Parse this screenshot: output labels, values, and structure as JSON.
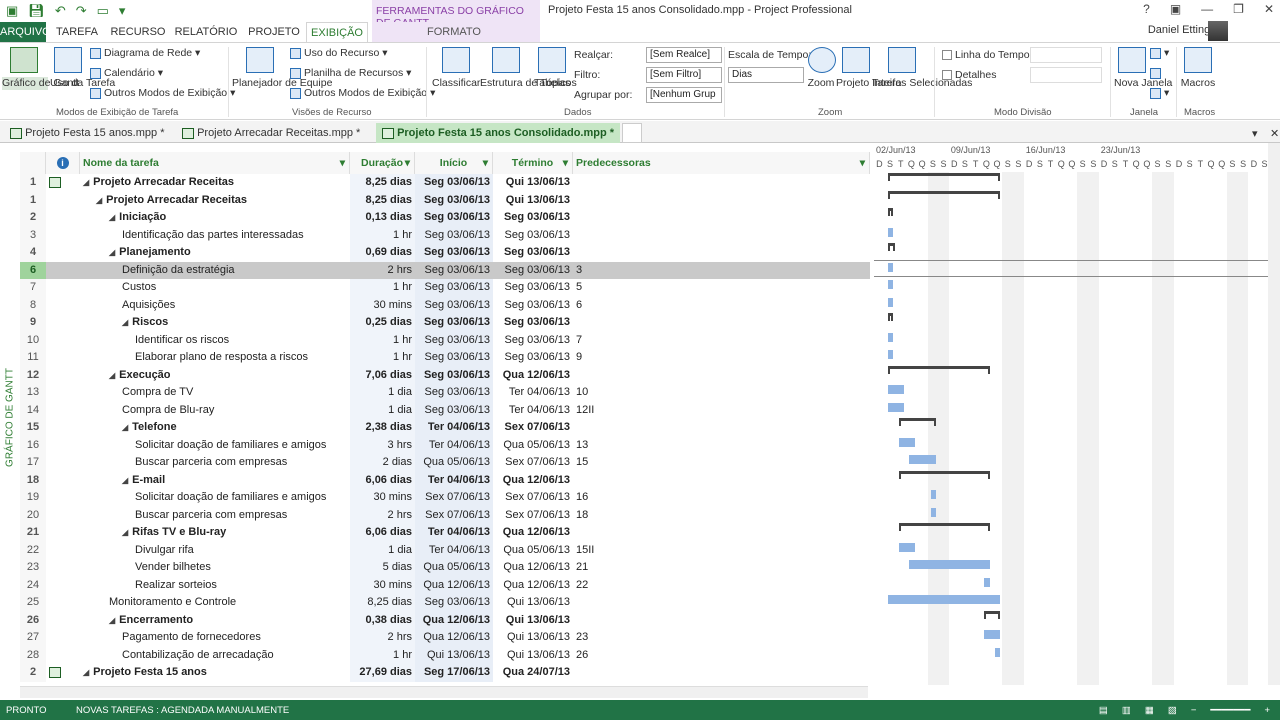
{
  "window": {
    "context_tab_group": "FERRAMENTAS DO GRÁFICO DE GANTT",
    "title": "Projeto Festa 15 anos Consolidado.mpp - Project Professional",
    "user_name": "Daniel Ettinger"
  },
  "ribbon_tabs": [
    "ARQUIVO",
    "TAREFA",
    "RECURSO",
    "RELATÓRIO",
    "PROJETO",
    "EXIBIÇÃO",
    "FORMATO"
  ],
  "ribbon": {
    "task_views": {
      "gantt": "Gráfico de Gantt",
      "task_usage": "Uso da Tarefa",
      "network": "Diagrama de Rede",
      "calendar": "Calendário",
      "other": "Outros Modos de Exibição",
      "label": "Modos de Exibição de Tarefa"
    },
    "resource_views": {
      "planner": "Planejador de Equipe",
      "resource_usage": "Uso do Recurso",
      "resource_sheet": "Planilha de Recursos",
      "other": "Outros Modos de Exibição",
      "label": "Visões de Recurso"
    },
    "data": {
      "sort": "Classificar",
      "outline": "Estrutura de Tópicos",
      "tables": "Tabelas",
      "highlight_label": "Realçar:",
      "highlight_value": "[Sem Realce]",
      "filter_label": "Filtro:",
      "filter_value": "[Sem Filtro]",
      "group_label": "Agrupar por:",
      "group_value": "[Nenhum Grup",
      "label": "Dados"
    },
    "zoom": {
      "timescale_label": "Escala de Tempo:",
      "timescale_value": "Dias",
      "zoom": "Zoom",
      "entire_project": "Projeto Inteiro",
      "selected_tasks": "Tarefas Selecionadas",
      "label": "Zoom"
    },
    "split": {
      "timeline": "Linha do Tempo",
      "details": "Detalhes",
      "label": "Modo Divisão"
    },
    "window": {
      "new_window": "Nova Janela",
      "label": "Janela"
    },
    "macros": {
      "macros": "Macros",
      "label": "Macros"
    }
  },
  "doc_tabs": [
    "Projeto Festa 15 anos.mpp *",
    "Projeto Arrecadar Receitas.mpp *",
    "Projeto Festa 15 anos Consolidado.mpp *"
  ],
  "side_label": "GRÁFICO DE GANTT",
  "columns": {
    "name": "Nome da tarefa",
    "duration": "Duração",
    "start": "Início",
    "finish": "Término",
    "predecessors": "Predecessoras"
  },
  "rows": [
    {
      "id": "1",
      "name": "Projeto Arrecadar Receitas",
      "dur": "8,25 dias",
      "start": "Seg 03/06/13",
      "end": "Qui 13/06/13",
      "pred": "",
      "level": 0,
      "summary": true,
      "icon": "subproject-icon"
    },
    {
      "id": "1",
      "name": "Projeto Arrecadar Receitas",
      "dur": "8,25 dias",
      "start": "Seg 03/06/13",
      "end": "Qui 13/06/13",
      "pred": "",
      "level": 1,
      "summary": true
    },
    {
      "id": "2",
      "name": "Iniciação",
      "dur": "0,13 dias",
      "start": "Seg 03/06/13",
      "end": "Seg 03/06/13",
      "pred": "",
      "level": 2,
      "summary": true
    },
    {
      "id": "3",
      "name": "Identificação das partes interessadas",
      "dur": "1 hr",
      "start": "Seg 03/06/13",
      "end": "Seg 03/06/13",
      "pred": "",
      "level": 3
    },
    {
      "id": "4",
      "name": "Planejamento",
      "dur": "0,69 dias",
      "start": "Seg 03/06/13",
      "end": "Seg 03/06/13",
      "pred": "",
      "level": 2,
      "summary": true
    },
    {
      "id": "6",
      "name": "Definição da estratégia",
      "dur": "2 hrs",
      "start": "Seg 03/06/13",
      "end": "Seg 03/06/13",
      "pred": "3",
      "level": 3,
      "selected": true
    },
    {
      "id": "7",
      "name": "Custos",
      "dur": "1 hr",
      "start": "Seg 03/06/13",
      "end": "Seg 03/06/13",
      "pred": "5",
      "level": 3
    },
    {
      "id": "8",
      "name": "Aquisições",
      "dur": "30 mins",
      "start": "Seg 03/06/13",
      "end": "Seg 03/06/13",
      "pred": "6",
      "level": 3
    },
    {
      "id": "9",
      "name": "Riscos",
      "dur": "0,25 dias",
      "start": "Seg 03/06/13",
      "end": "Seg 03/06/13",
      "pred": "",
      "level": 3,
      "summary": true
    },
    {
      "id": "10",
      "name": "Identificar os riscos",
      "dur": "1 hr",
      "start": "Seg 03/06/13",
      "end": "Seg 03/06/13",
      "pred": "7",
      "level": 4
    },
    {
      "id": "11",
      "name": "Elaborar plano de resposta a riscos",
      "dur": "1 hr",
      "start": "Seg 03/06/13",
      "end": "Seg 03/06/13",
      "pred": "9",
      "level": 4
    },
    {
      "id": "12",
      "name": "Execução",
      "dur": "7,06 dias",
      "start": "Seg 03/06/13",
      "end": "Qua 12/06/13",
      "pred": "",
      "level": 2,
      "summary": true
    },
    {
      "id": "13",
      "name": "Compra de TV",
      "dur": "1 dia",
      "start": "Seg 03/06/13",
      "end": "Ter 04/06/13",
      "pred": "10",
      "level": 3
    },
    {
      "id": "14",
      "name": "Compra de Blu-ray",
      "dur": "1 dia",
      "start": "Seg 03/06/13",
      "end": "Ter 04/06/13",
      "pred": "12II",
      "level": 3
    },
    {
      "id": "15",
      "name": "Telefone",
      "dur": "2,38 dias",
      "start": "Ter 04/06/13",
      "end": "Sex 07/06/13",
      "pred": "",
      "level": 3,
      "summary": true
    },
    {
      "id": "16",
      "name": "Solicitar doação de familiares e amigos",
      "dur": "3 hrs",
      "start": "Ter 04/06/13",
      "end": "Qua 05/06/13",
      "pred": "13",
      "level": 4
    },
    {
      "id": "17",
      "name": "Buscar parceria com empresas",
      "dur": "2 dias",
      "start": "Qua 05/06/13",
      "end": "Sex 07/06/13",
      "pred": "15",
      "level": 4
    },
    {
      "id": "18",
      "name": "E-mail",
      "dur": "6,06 dias",
      "start": "Ter 04/06/13",
      "end": "Qua 12/06/13",
      "pred": "",
      "level": 3,
      "summary": true
    },
    {
      "id": "19",
      "name": "Solicitar doação de familiares e amigos",
      "dur": "30 mins",
      "start": "Sex 07/06/13",
      "end": "Sex 07/06/13",
      "pred": "16",
      "level": 4
    },
    {
      "id": "20",
      "name": "Buscar parceria com empresas",
      "dur": "2 hrs",
      "start": "Sex 07/06/13",
      "end": "Sex 07/06/13",
      "pred": "18",
      "level": 4
    },
    {
      "id": "21",
      "name": "Rifas TV e Blu-ray",
      "dur": "6,06 dias",
      "start": "Ter 04/06/13",
      "end": "Qua 12/06/13",
      "pred": "",
      "level": 3,
      "summary": true
    },
    {
      "id": "22",
      "name": "Divulgar rifa",
      "dur": "1 dia",
      "start": "Ter 04/06/13",
      "end": "Qua 05/06/13",
      "pred": "15II",
      "level": 4
    },
    {
      "id": "23",
      "name": "Vender bilhetes",
      "dur": "5 dias",
      "start": "Qua 05/06/13",
      "end": "Qua 12/06/13",
      "pred": "21",
      "level": 4
    },
    {
      "id": "24",
      "name": "Realizar sorteios",
      "dur": "30 mins",
      "start": "Qua 12/06/13",
      "end": "Qua 12/06/13",
      "pred": "22",
      "level": 4
    },
    {
      "id": "25",
      "name": "Monitoramento e Controle",
      "dur": "8,25 dias",
      "start": "Seg 03/06/13",
      "end": "Qui 13/06/13",
      "pred": "",
      "level": 2
    },
    {
      "id": "26",
      "name": "Encerramento",
      "dur": "0,38 dias",
      "start": "Qua 12/06/13",
      "end": "Qui 13/06/13",
      "pred": "",
      "level": 2,
      "summary": true
    },
    {
      "id": "27",
      "name": "Pagamento de fornecedores",
      "dur": "2 hrs",
      "start": "Qua 12/06/13",
      "end": "Qui 13/06/13",
      "pred": "23",
      "level": 3
    },
    {
      "id": "28",
      "name": "Contabilização de arrecadação",
      "dur": "1 hr",
      "start": "Qui 13/06/13",
      "end": "Qui 13/06/13",
      "pred": "26",
      "level": 3
    },
    {
      "id": "2",
      "name": "Projeto Festa 15 anos",
      "dur": "27,69 dias",
      "start": "Seg 17/06/13",
      "end": "Qua 24/07/13",
      "pred": "",
      "level": 0,
      "summary": true,
      "icon": "subproject-icon"
    }
  ],
  "timescale": {
    "weeks": [
      "02/Jun/13",
      "09/Jun/13",
      "16/Jun/13",
      "23/Jun/13"
    ],
    "days": [
      "D",
      "S",
      "T",
      "Q",
      "Q",
      "S",
      "S",
      "D",
      "S",
      "T",
      "Q",
      "Q",
      "S",
      "S",
      "D",
      "S",
      "T",
      "Q",
      "Q",
      "S",
      "S",
      "D",
      "S",
      "T",
      "Q",
      "Q",
      "S",
      "S",
      "D",
      "S",
      "T",
      "Q",
      "Q",
      "S",
      "S",
      "D",
      "S",
      "T",
      "Q",
      "Q",
      "S",
      "S"
    ]
  },
  "status": {
    "ready": "PRONTO",
    "new_tasks": "NOVAS TAREFAS : AGENDADA MANUALMENTE"
  }
}
